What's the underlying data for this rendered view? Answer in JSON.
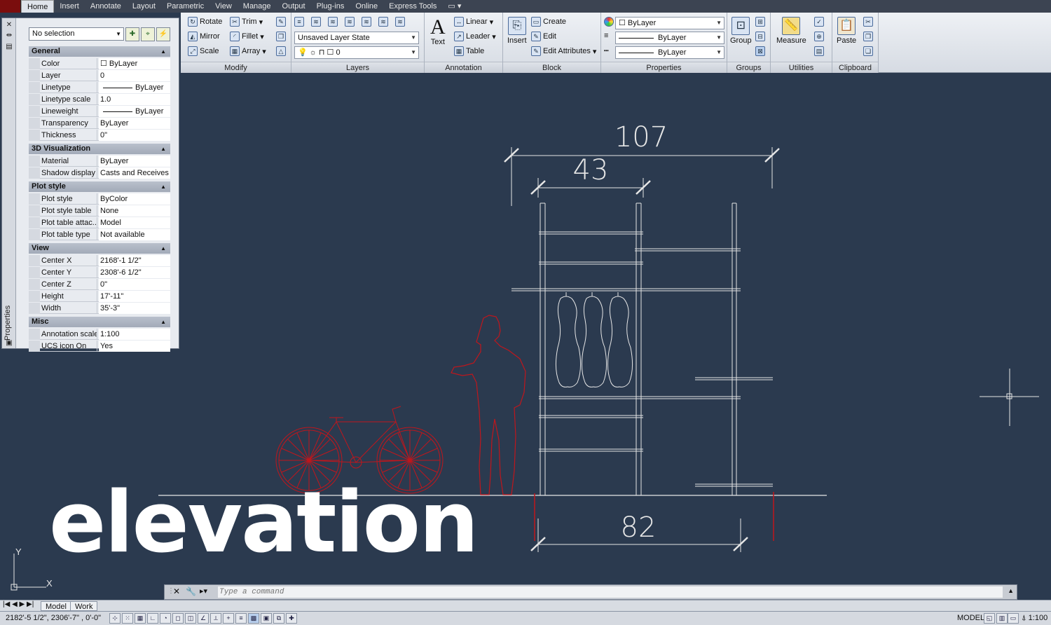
{
  "menubar": {
    "tabs": [
      "Home",
      "Insert",
      "Annotate",
      "Layout",
      "Parametric",
      "View",
      "Manage",
      "Output",
      "Plug-ins",
      "Online",
      "Express Tools"
    ],
    "active": "Home",
    "extra": "▭ ▾"
  },
  "ribbon": {
    "modify": {
      "label": "Modify",
      "rotate": "Rotate",
      "trim": "Trim",
      "mirror": "Mirror",
      "fillet": "Fillet",
      "scale": "Scale",
      "array": "Array"
    },
    "layers": {
      "label": "Layers",
      "layer_state": "Unsaved Layer State",
      "current_layer": "0"
    },
    "annotation": {
      "label": "Annotation",
      "text": "Text",
      "linear": "Linear",
      "leader": "Leader",
      "table": "Table"
    },
    "block": {
      "label": "Block",
      "insert": "Insert",
      "create": "Create",
      "edit": "Edit",
      "edit_attributes": "Edit Attributes"
    },
    "properties": {
      "label": "Properties",
      "color": "ByLayer",
      "linetype": "ByLayer",
      "lineweight": "ByLayer"
    },
    "groups": {
      "label": "Groups",
      "group": "Group"
    },
    "utilities": {
      "label": "Utilities",
      "measure": "Measure"
    },
    "clipboard": {
      "label": "Clipboard",
      "paste": "Paste"
    }
  },
  "properties_palette": {
    "title": "Properties",
    "selection": "No selection",
    "sections": [
      {
        "name": "General",
        "rows": [
          {
            "name": "Color",
            "value": "ByLayer"
          },
          {
            "name": "Layer",
            "value": "0"
          },
          {
            "name": "Linetype",
            "value": "ByLayer"
          },
          {
            "name": "Linetype scale",
            "value": "1.0"
          },
          {
            "name": "Lineweight",
            "value": "ByLayer"
          },
          {
            "name": "Transparency",
            "value": "ByLayer"
          },
          {
            "name": "Thickness",
            "value": "0\""
          }
        ]
      },
      {
        "name": "3D Visualization",
        "rows": [
          {
            "name": "Material",
            "value": "ByLayer"
          },
          {
            "name": "Shadow display",
            "value": "Casts and Receives ..."
          }
        ]
      },
      {
        "name": "Plot style",
        "rows": [
          {
            "name": "Plot style",
            "value": "ByColor"
          },
          {
            "name": "Plot style table",
            "value": "None"
          },
          {
            "name": "Plot table attac...",
            "value": "Model"
          },
          {
            "name": "Plot table type",
            "value": "Not available"
          }
        ]
      },
      {
        "name": "View",
        "rows": [
          {
            "name": "Center X",
            "value": "2168'-1 1/2\""
          },
          {
            "name": "Center Y",
            "value": "2308'-6 1/2\""
          },
          {
            "name": "Center Z",
            "value": "0\""
          },
          {
            "name": "Height",
            "value": "17'-11\""
          },
          {
            "name": "Width",
            "value": "35'-3\""
          }
        ]
      },
      {
        "name": "Misc",
        "rows": [
          {
            "name": "Annotation scale",
            "value": "1:100"
          },
          {
            "name": "UCS icon On",
            "value": "Yes"
          }
        ]
      }
    ]
  },
  "drawing": {
    "dimensions": {
      "overall_width": "107",
      "upper_width": "43",
      "base_width": "82"
    },
    "overlay_text": "elevation",
    "ucs": {
      "x": "X",
      "y": "Y"
    }
  },
  "command_line": {
    "placeholder": "Type a command"
  },
  "layout_tabs": [
    "Model",
    "Work"
  ],
  "status_bar": {
    "coordinates": "2182'-5 1/2\", 2306'-7\"  , 0'-0\"",
    "space": "MODEL",
    "scale": "1:100"
  },
  "colors": {
    "canvas": "#2b3a4f",
    "entity_white": "#e6e6e6",
    "entity_red": "#c0161c"
  }
}
